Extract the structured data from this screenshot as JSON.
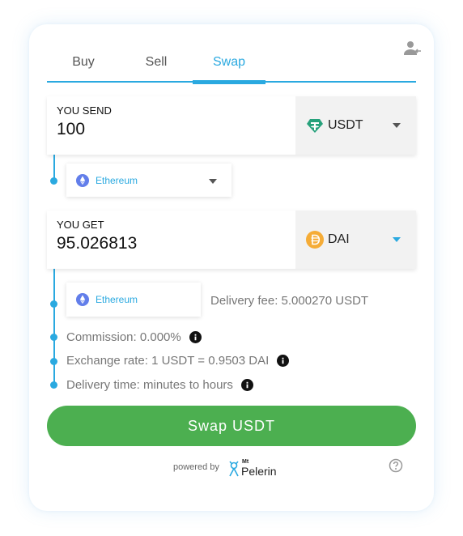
{
  "tabs": [
    {
      "label": "Buy",
      "active": false
    },
    {
      "label": "Sell",
      "active": false
    },
    {
      "label": "Swap",
      "active": true
    }
  ],
  "send": {
    "label": "YOU SEND",
    "amount": "100",
    "token": "USDT",
    "token_icon": "tether-icon",
    "network": "Ethereum",
    "network_icon": "ethereum-icon"
  },
  "get": {
    "label": "YOU GET",
    "amount": "95.026813",
    "token": "DAI",
    "token_icon": "dai-icon",
    "network": "Ethereum",
    "network_icon": "ethereum-icon",
    "delivery_fee": "Delivery fee: 5.000270 USDT"
  },
  "details": {
    "commission": "Commission: 0.000%",
    "exchange_rate": "Exchange rate: 1 USDT = 0.9503 DAI",
    "delivery_time": "Delivery time: minutes to hours"
  },
  "swap_button": "Swap USDT",
  "footer": {
    "powered_by": "powered by",
    "brand_small": "Mt",
    "brand": "Pelerin"
  },
  "colors": {
    "accent": "#2aa9e0",
    "button": "#4caf50",
    "usdt": "#26a17b",
    "dai": "#f5ac37",
    "ethereum": "#627eea"
  }
}
